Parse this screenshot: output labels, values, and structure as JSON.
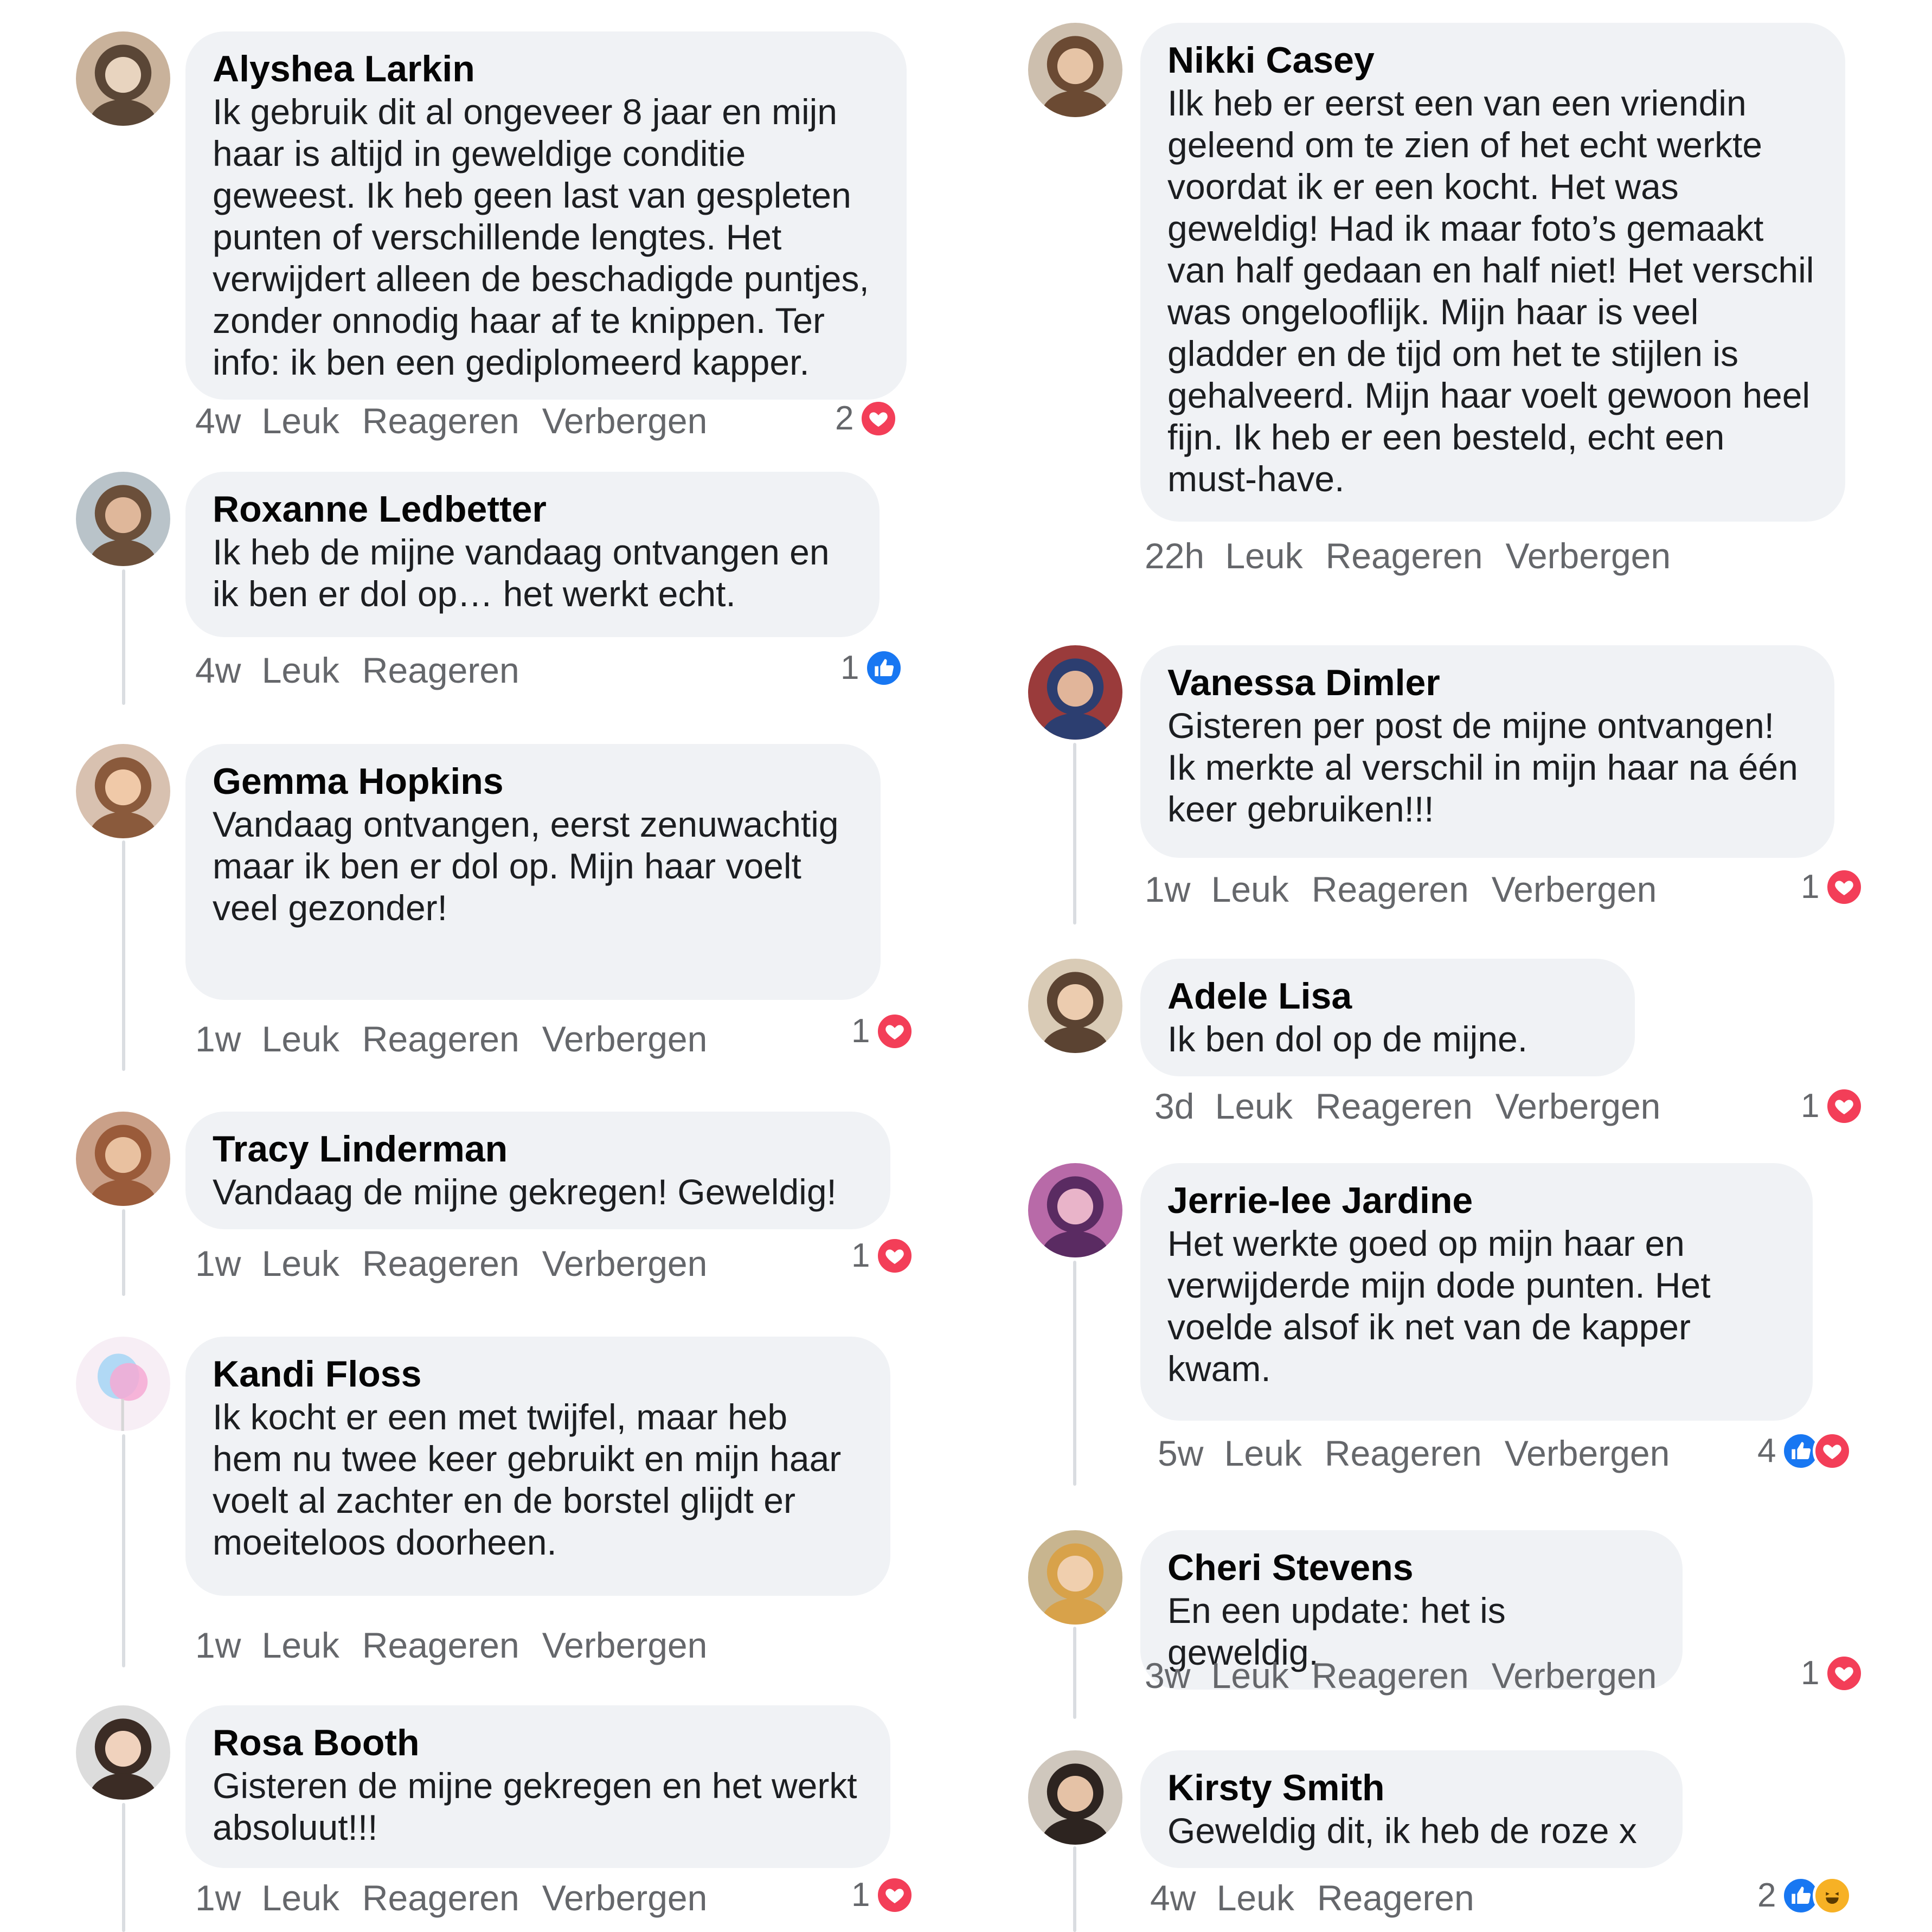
{
  "colors": {
    "bubble": "#f0f2f5",
    "meta_text": "#65676b",
    "love": "#f33e58",
    "like": "#1877f2",
    "haha": "#f7b125"
  },
  "left": [
    {
      "name": "Alyshea Larkin",
      "text": "Ik gebruik dit al ongeveer 8 jaar en mijn haar is altijd in geweldige conditie geweest. Ik heb geen last van gespleten punten of verschillende lengtes. Het verwijdert alleen de beschadigde puntjes, zonder onnodig haar af te knippen. Ter info: ik ben een gediplomeerd kapper.",
      "time": "4w",
      "like": "Leuk",
      "reply": "Reageren",
      "hide": "Verbergen",
      "reaction_count": "2",
      "reactions": [
        "love-icon"
      ]
    },
    {
      "name": "Roxanne Ledbetter",
      "text": "Ik heb de mijne vandaag ontvangen en ik ben er dol op… het werkt echt.",
      "time": "4w",
      "like": "Leuk",
      "reply": "Reageren",
      "reaction_count": "1",
      "reactions": [
        "like-icon"
      ]
    },
    {
      "name": "Gemma Hopkins",
      "text": "Vandaag ontvangen, eerst zenuwachtig maar ik ben er dol op. Mijn haar voelt veel gezonder!",
      "time": "1w",
      "like": "Leuk",
      "reply": "Reageren",
      "hide": "Verbergen",
      "reaction_count": "1",
      "reactions": [
        "love-icon"
      ]
    },
    {
      "name": "Tracy Linderman",
      "text": "Vandaag de mijne gekregen! Geweldig!",
      "time": "1w",
      "like": "Leuk",
      "reply": "Reageren",
      "hide": "Verbergen",
      "reaction_count": "1",
      "reactions": [
        "love-icon"
      ]
    },
    {
      "name": "Kandi Floss",
      "text": "Ik kocht er een met twijfel, maar heb hem nu twee keer gebruikt en mijn haar voelt al zachter en de borstel glijdt er moeiteloos doorheen.",
      "time": "1w",
      "like": "Leuk",
      "reply": "Reageren",
      "hide": "Verbergen"
    },
    {
      "name": "Rosa Booth",
      "text": "Gisteren de mijne gekregen en het werkt absoluut!!!",
      "time": "1w",
      "like": "Leuk",
      "reply": "Reageren",
      "hide": "Verbergen",
      "reaction_count": "1",
      "reactions": [
        "love-icon"
      ]
    }
  ],
  "right": [
    {
      "name": "Nikki Casey",
      "text": "Ilk heb er eerst een van een vriendin geleend om te zien of het echt werkte voordat ik er een kocht. Het was geweldig! Had ik maar foto’s gemaakt van half gedaan en half niet! Het verschil was ongelooflijk. Mijn haar is veel gladder en de tijd om het te stijlen is gehalveerd. Mijn haar voelt gewoon heel fijn. Ik heb er een besteld, echt een must-have.",
      "time": "22h",
      "like": "Leuk",
      "reply": "Reageren",
      "hide": "Verbergen"
    },
    {
      "name": "Vanessa Dimler",
      "text": "Gisteren per post de mijne ontvangen! Ik merkte al verschil in mijn haar na één keer gebruiken!!!",
      "time": "1w",
      "like": "Leuk",
      "reply": "Reageren",
      "hide": "Verbergen",
      "reaction_count": "1",
      "reactions": [
        "love-icon"
      ]
    },
    {
      "name": "Adele Lisa",
      "text": "Ik ben dol op de mijne.",
      "time": "3d",
      "like": "Leuk",
      "reply": "Reageren",
      "hide": "Verbergen",
      "reaction_count": "1",
      "reactions": [
        "love-icon"
      ]
    },
    {
      "name": "Jerrie-lee Jardine",
      "text": "Het werkte goed op mijn haar en verwijderde mijn dode punten. Het voelde alsof ik net van de kapper kwam.",
      "time": "5w",
      "like": "Leuk",
      "reply": "Reageren",
      "hide": "Verbergen",
      "reaction_count": "4",
      "reactions": [
        "like-icon",
        "love-icon"
      ]
    },
    {
      "name": "Cheri Stevens",
      "text": "En een update: het is geweldig.",
      "time": "3w",
      "like": "Leuk",
      "reply": "Reageren",
      "hide": "Verbergen",
      "reaction_count": "1",
      "reactions": [
        "love-icon"
      ]
    },
    {
      "name": "Kirsty Smith",
      "text": "Geweldig dit, ik heb de roze x",
      "time": "4w",
      "like": "Leuk",
      "reply": "Reageren",
      "reaction_count": "2",
      "reactions": [
        "like-icon",
        "haha-icon"
      ]
    }
  ]
}
